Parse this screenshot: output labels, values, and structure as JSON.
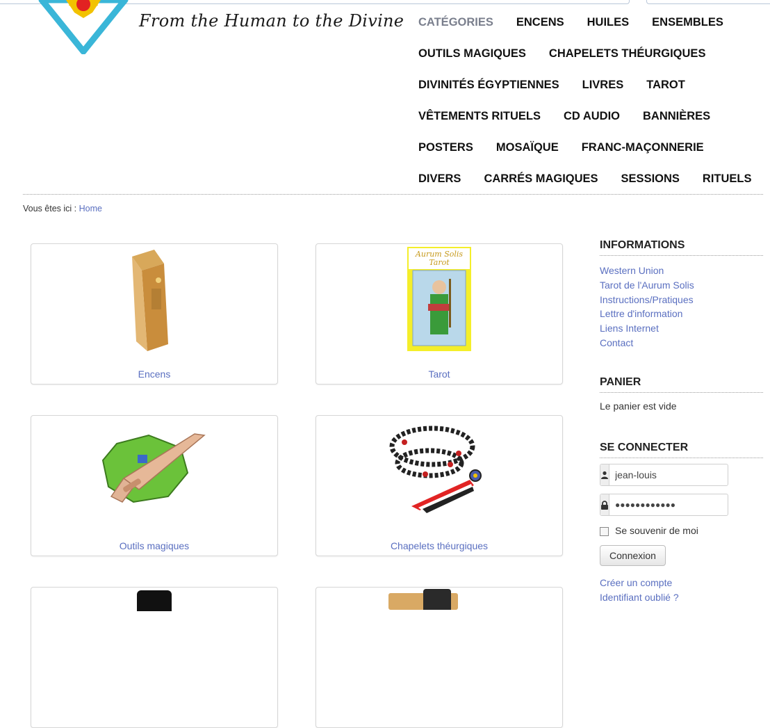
{
  "header": {
    "tagline": "From the Human to the Divine",
    "menu_rows": [
      [
        "CATÉGORIES",
        "ENCENS",
        "HUILES",
        "ENSEMBLES"
      ],
      [
        "OUTILS MAGIQUES",
        "CHAPELETS THÉURGIQUES"
      ],
      [
        "DIVINITÉS ÉGYPTIENNES",
        "LIVRES",
        "TAROT"
      ],
      [
        "VÊTEMENTS RITUELS",
        "CD AUDIO",
        "BANNIÈRES"
      ],
      [
        "POSTERS",
        "MOSAÏQUE",
        "FRANC-MAÇONNERIE"
      ],
      [
        "DIVERS",
        "CARRÉS MAGIQUES",
        "SESSIONS",
        "RITUELS"
      ]
    ]
  },
  "breadcrumb": {
    "prefix": "Vous êtes ici :",
    "home": "Home"
  },
  "categories": [
    {
      "label": "Encens",
      "icon": "incense-box-image"
    },
    {
      "label": "Tarot",
      "icon": "tarot-card-image"
    },
    {
      "label": "Outils magiques",
      "icon": "magic-dagger-image"
    },
    {
      "label": "Chapelets théurgiques",
      "icon": "rosary-beads-image"
    }
  ],
  "sidebar": {
    "info_title": "INFORMATIONS",
    "info_links": [
      "Western Union",
      "Tarot de l'Aurum Solis",
      "Instructions/Pratiques",
      "Lettre d'information",
      "Liens Internet",
      "Contact"
    ],
    "cart_title": "PANIER",
    "cart_empty": "Le panier est vide",
    "login_title": "SE CONNECTER",
    "username_value": "jean-louis",
    "password_value": "●●●●●●●●●●●●",
    "remember_label": "Se souvenir de moi",
    "login_button": "Connexion",
    "create_account": "Créer un compte",
    "forgot": "Identifiant oublié ?"
  },
  "tarot_card_text": [
    "Aurum Solis",
    "Tarot"
  ],
  "colors": {
    "link": "#5a6fc0",
    "menu_active": "#7a7f8d",
    "menu": "#111111"
  }
}
